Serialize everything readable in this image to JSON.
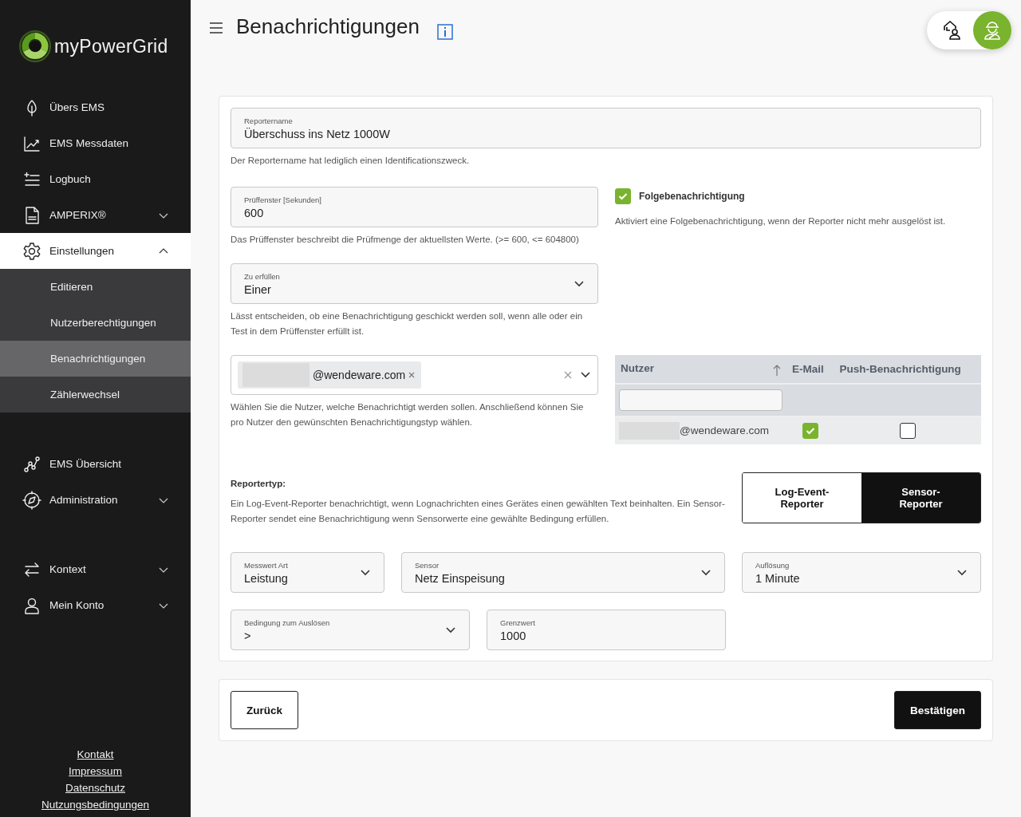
{
  "app": {
    "logo_text": "myPowerGrid"
  },
  "sidebar": {
    "groups": [
      [
        {
          "label": "Übers EMS",
          "selected": false
        },
        {
          "label": "EMS Messdaten",
          "selected": false
        },
        {
          "label": "Logbuch",
          "selected": false
        },
        {
          "label": "AMPERIX®",
          "selected": false,
          "expanded": false
        },
        {
          "label": "Einstellungen",
          "selected": true,
          "expanded": true,
          "children": [
            {
              "label": "Editieren",
              "selected": false
            },
            {
              "label": "Nutzerberechtigungen",
              "selected": false
            },
            {
              "label": "Benachrichtigungen",
              "selected": true
            },
            {
              "label": "Zählerwechsel",
              "selected": false
            }
          ]
        }
      ],
      [
        {
          "label": "EMS Übersicht",
          "selected": false
        },
        {
          "label": "Administration",
          "selected": false,
          "expanded": false
        }
      ],
      [
        {
          "label": "Kontext",
          "selected": false,
          "expanded": false
        },
        {
          "label": "Mein Konto",
          "selected": false,
          "expanded": false
        }
      ]
    ],
    "footer_links": [
      "Kontakt",
      "Impressum",
      "Datenschutz",
      "Nutzungsbedingungen"
    ]
  },
  "header": {
    "title": "Benachrichtigungen"
  },
  "role_switch": [
    {
      "selected": false
    },
    {
      "selected": true
    }
  ],
  "form": {
    "reporter_name": {
      "label": "Reportername",
      "value": "Überschuss ins Netz 1000W",
      "hint": "Der Reportername hat lediglich einen Identificationszweck."
    },
    "check_window": {
      "label": "Prüffenster [Sekunden]",
      "value": "600",
      "hint": "Das Prüffenster beschreibt die Prüfmenge der aktuellsten Werte. (>= 600, <= 604800)"
    },
    "fulfil": {
      "label": "Zu erfüllen",
      "value": "Einer",
      "hint": "Lässt entscheiden, ob eine Benachrichtigung geschickt werden soll, wenn alle oder ein Test in dem Prüffenster erfüllt ist."
    },
    "follow_up": {
      "label": "Folgebenachrichtigung",
      "checked": true,
      "hint": "Aktiviert eine Folgebenachrichtigung, wenn der Reporter nicht mehr ausgelöst ist."
    },
    "users_select": {
      "tags": [
        {
          "text": "@wendeware.com",
          "masked": true
        }
      ],
      "hint": "Wählen Sie die Nutzer, welche Benachrichtigt werden sollen. Anschließend können Sie pro Nutzer den gewünschten Benachrichtigungstyp wählen."
    },
    "users_table": {
      "columns": [
        "Nutzer",
        "E-Mail",
        "Push-Benachrichtigung"
      ],
      "rows": [
        {
          "user": "@wendeware.com",
          "masked": true,
          "email": true,
          "push": false
        }
      ]
    },
    "reporter_type": {
      "label": "Reportertyp:",
      "hint": "Ein Log-Event-Reporter benachrichtigt, wenn Lognachrichten eines Gerätes einen gewählten Text beinhalten. Ein Sensor-Reporter sendet eine Benachrichtigung wenn Sensorwerte eine gewählte Bedingung erfüllen.",
      "options": [
        {
          "label": "Log-Event-Reporter",
          "selected": false
        },
        {
          "label": "Sensor-Reporter",
          "selected": true
        }
      ]
    },
    "sensor_fields": [
      {
        "kind": "select",
        "label": "Messwert Art",
        "value": "Leistung"
      },
      {
        "kind": "select",
        "label": "Sensor",
        "value": "Netz Einspeisung"
      },
      {
        "kind": "select",
        "label": "Auflösung",
        "value": "1 Minute"
      },
      {
        "kind": "select",
        "label": "Bedingung zum Auslösen",
        "value": ">"
      },
      {
        "kind": "input",
        "label": "Grenzwert",
        "value": "1000"
      }
    ]
  },
  "buttons": {
    "back": "Zurück",
    "confirm": "Bestätigen"
  }
}
